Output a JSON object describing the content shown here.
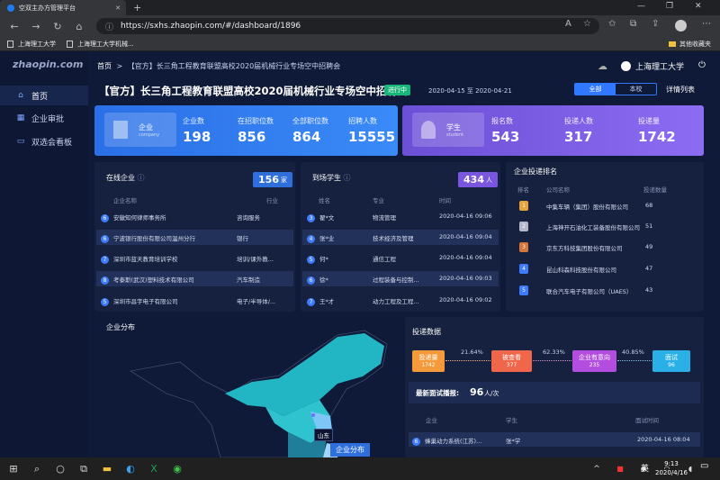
{
  "browser": {
    "tab_title": "空双主办方管理平台",
    "url": "https://sxhs.zhaopin.com/#/dashboard/1896",
    "bookmarks": [
      "上海理工大学",
      "上海理工大学机械..."
    ],
    "other_bookmarks": "其他收藏夹"
  },
  "sidebar": {
    "logo": "zhaopin.com",
    "items": [
      {
        "label": "首页",
        "icon": "home-icon"
      },
      {
        "label": "企业审批",
        "icon": "calendar-icon"
      },
      {
        "label": "双选会看板",
        "icon": "monitor-icon"
      }
    ]
  },
  "header": {
    "breadcrumb_home": "首页",
    "breadcrumb_sep": ">",
    "breadcrumb_current": "【官方】长三角工程教育联盟高校2020届机械行业专场空中招聘会",
    "user": "上海理工大学"
  },
  "event": {
    "title": "【官方】长三角工程教育联盟高校2020届机械行业专场空中招聘会",
    "status": "进行中",
    "date_range": "2020-04-15 至 2020-04-21",
    "scope_options": [
      "全部",
      "本校"
    ],
    "scope_selected": "全部",
    "detail_link": "详情列表"
  },
  "enterprise_card": {
    "label": "企业",
    "sublabel": "company",
    "stats": [
      {
        "label": "企业数",
        "value": "198"
      },
      {
        "label": "在招职位数",
        "value": "856"
      },
      {
        "label": "全部职位数",
        "value": "864"
      },
      {
        "label": "招聘人数",
        "value": "15555"
      }
    ]
  },
  "student_card": {
    "label": "学生",
    "sublabel": "student",
    "stats": [
      {
        "label": "报名数",
        "value": "543"
      },
      {
        "label": "投递人数",
        "value": "317"
      },
      {
        "label": "投递量",
        "value": "1742"
      }
    ]
  },
  "online_companies": {
    "title": "在线企业",
    "count": "156",
    "unit": "家",
    "headers": [
      "企业名称",
      "行业"
    ],
    "rows": [
      {
        "n": "6",
        "name": "安徽知何律师事务所",
        "industry": "咨询服务"
      },
      {
        "n": "6",
        "name": "宁波银行股份有限公司温州分行",
        "industry": "银行"
      },
      {
        "n": "7",
        "name": "深圳市蓝天教育培训学校",
        "industry": "培训/课外教..."
      },
      {
        "n": "8",
        "name": "考泰斯(武汉)塑料技术有限公司",
        "industry": "汽车制造"
      },
      {
        "n": "5",
        "name": "深圳市昌宇电子有限公司",
        "industry": "电子/半导体/..."
      }
    ]
  },
  "arrived_students": {
    "title": "到场学生",
    "count": "434",
    "unit": "人",
    "headers": [
      "姓名",
      "专业",
      "时间"
    ],
    "rows": [
      {
        "n": "3",
        "name": "翟*文",
        "major": "物流管理",
        "time": "2020-04-16 09:06"
      },
      {
        "n": "4",
        "name": "张*业",
        "major": "技术经济及管理",
        "time": "2020-04-16 09:04"
      },
      {
        "n": "5",
        "name": "何*",
        "major": "通信工程",
        "time": "2020-04-16 09:04"
      },
      {
        "n": "6",
        "name": "徐*",
        "major": "过程装备与控制...",
        "time": "2020-04-16 09:03"
      },
      {
        "n": "7",
        "name": "王*才",
        "major": "动力工程及工程...",
        "time": "2020-04-16 09:02"
      }
    ]
  },
  "ranking": {
    "title": "企业投递排名",
    "headers": [
      "排名",
      "公司名称",
      "投递数量"
    ],
    "rows": [
      {
        "rank": "1",
        "company": "中集车辆（集团）股份有限公司",
        "count": "68"
      },
      {
        "rank": "2",
        "company": "上海神开石油化工装备股份有限公司",
        "count": "51"
      },
      {
        "rank": "3",
        "company": "京东方科技集团股份有限公司",
        "count": "49"
      },
      {
        "rank": "4",
        "company": "昆山科森科技股份有限公司",
        "count": "47"
      },
      {
        "rank": "5",
        "company": "联合汽车电子有限公司（UAES）",
        "count": "43"
      }
    ]
  },
  "map": {
    "title": "企业分布",
    "province_label": "山东",
    "legend_label": "企业分布"
  },
  "delivery": {
    "title": "投递数据",
    "funnel": [
      {
        "label": "投递量",
        "value": "1742",
        "color": "#f59a3a"
      },
      {
        "label": "被查看",
        "value": "377",
        "color": "#f0664a"
      },
      {
        "label": "企业有意向",
        "value": "235",
        "color": "#b24de0"
      },
      {
        "label": "面试",
        "value": "96",
        "color": "#2ab0e6"
      }
    ],
    "rates": [
      "21.64%",
      "62.33%",
      "40.85%"
    ],
    "latest_label": "最新面试播报:",
    "latest_count": "96",
    "latest_unit": "人/次",
    "headers": [
      "企业",
      "学生",
      "面试时间"
    ],
    "rows": [
      {
        "n": "6",
        "company": "蜂巢动力系统(江苏)...",
        "student": "张*学",
        "time": "2020-04-16 08:04"
      }
    ]
  },
  "taskbar": {
    "ime": "英",
    "time": "9:13",
    "date": "2020/4/16"
  }
}
